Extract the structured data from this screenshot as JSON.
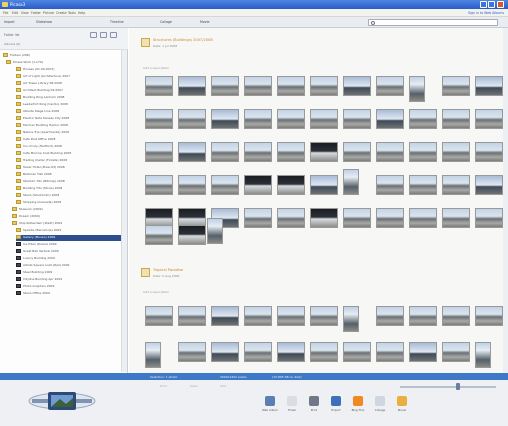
{
  "window": {
    "title": "Picasa3",
    "help_link": "Sign in to Web Albums"
  },
  "menu": [
    "File",
    "Edit",
    "View",
    "Folder",
    "Picture",
    "Create",
    "Tools",
    "Help"
  ],
  "toolbar": [
    "Import",
    "Slideshow",
    "Timeline",
    "Collage",
    "Movie"
  ],
  "sidebar": {
    "title": "Folder list",
    "subtitle": "Albums (6)",
    "rows": [
      "Folders (298)",
      "Picasa Work (1,179)",
      "Houses (01.09.2007)",
      "Art of Light (Architecture) 2007",
      "Art Tower Library 08.2008",
      "Architect Building 06.2007",
      "Building Ring Lanham 2008",
      "Leaderfort Ring (Cardio) 2008",
      "Atlanta Stage Line 2008",
      "Electric Note Kansas City 2008",
      "Fairman Building Harbor 2008",
      "Nature Trip (Apartments) 2008",
      "Cafe Post Office 2008",
      "Inn of Lily (Hartford) 2008",
      "Cafe Morrow Club Building 2008",
      "Trading (Cellar (Tickets) 2008",
      "Tower Hotel (Prescott) 2008",
      "Barbican Hall 2008",
      "Stadium Tito (Bitmap) 2008",
      "Building Tito (Stone) 2008",
      "Stairs (Stockholm) 2008",
      "Stopping (Granada) 2008",
      "Museum (2009)",
      "Dream (2009)",
      "Ship Rotterdam (Stadt) 2009",
      "Spainte (Barcelona) 2009",
      "Gallery (Museo) 2009",
      "Ice Eden (Dubai) 2009",
      "Great Ball Vertical 2009",
      "Luxury Building 2009",
      "Artists Square Lodz (Rail) 2009",
      "Steel Building 2009",
      "Cityline Building Apr 2009",
      "Photo Graphics 2009",
      "Stairs Office 2009"
    ],
    "selected_row": 26
  },
  "groups": [
    {
      "title": "Structures (Buildings) 2007/2008",
      "subtitle": "Date: 1 Jul 2008",
      "label": "Add a description"
    },
    {
      "title": "Tropical Paradise",
      "subtitle": "Date: 5 Aug 2009",
      "label": "Add a description"
    }
  ],
  "status": {
    "left": "Selection: 1 photo",
    "middle": "2600x1952 pixels",
    "right": "(15,895 KB on disk)"
  },
  "tray": {
    "logo": "picasa-logo-icon",
    "controls": [
      "Hold",
      "Clear",
      "Add"
    ],
    "buttons": [
      {
        "label": "Web Album",
        "icon": "globe-icon",
        "color": "#5b7fb0"
      },
      {
        "label": "Email",
        "icon": "mail-icon",
        "color": "#d9dde3"
      },
      {
        "label": "Print",
        "icon": "printer-icon",
        "color": "#6f7886"
      },
      {
        "label": "Export",
        "icon": "export-icon",
        "color": "#3e6fb8"
      },
      {
        "label": "Blog This",
        "icon": "blogger-icon",
        "color": "#f08a20"
      },
      {
        "label": "Collage",
        "icon": "collage-icon",
        "color": "#d0d6df"
      },
      {
        "label": "Movie",
        "icon": "movie-icon",
        "color": "#e8b040"
      }
    ]
  }
}
